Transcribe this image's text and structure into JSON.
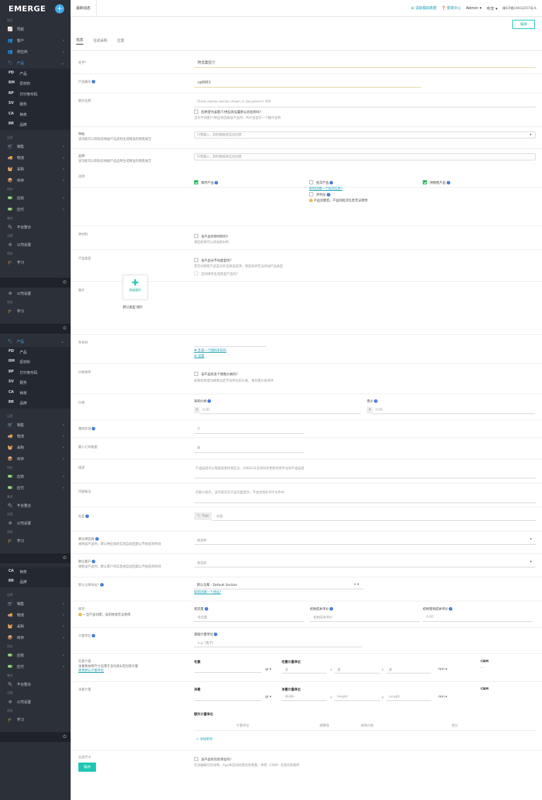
{
  "app": {
    "logo": "EMERGE",
    "news_tab": "最新动态"
  },
  "topbar": {
    "clear_demo": "清除模拟数据",
    "help": "帮助中心",
    "user": "Admin",
    "lang": "中文",
    "icp": "闽ICP备19012257号-6"
  },
  "sidebar": {
    "sec1": "报告",
    "nav": "导航",
    "customer": "客户",
    "supplier": "供应商",
    "product": "产品",
    "subs": [
      {
        "ab": "PD",
        "label": "产品"
      },
      {
        "ab": "RM",
        "label": "原材料"
      },
      {
        "ab": "BP",
        "label": "打印条形码"
      },
      {
        "ab": "SV",
        "label": "服务"
      },
      {
        "ab": "CA",
        "label": "种类"
      },
      {
        "ab": "BR",
        "label": "品牌"
      }
    ],
    "sec2": "运营",
    "sales": "销售",
    "logistics": "物流",
    "purchase": "采购",
    "inventory": "库存",
    "sec3": "财务",
    "receivable": "应收",
    "payable": "应付",
    "sec4": "集成",
    "platform": "平台整合",
    "sec5": "设置",
    "company": "公司设置",
    "sec6": "帮助",
    "learn": "学习"
  },
  "form": {
    "save_top": "保存",
    "tabs": [
      "信息",
      "往返采购",
      "位置"
    ],
    "name_label": "名字*",
    "name_value": "阿戈莫拉汀",
    "code_label": "产品编号",
    "code_value": "cp0001",
    "alias_label": "额外名称",
    "alias_hint": "These names will be shown in document's PDF",
    "alias_check": "您希望为该客户/供应商设置默认的名称吗?",
    "alias_desc": "当为不同客户/供应商选择该产品时，PDF会显示一个额外名称",
    "category_label": "种类",
    "category_desc": "该功能可以帮助您根据产品类别生成精准的销售报告",
    "category_ph": "只需输入，新的数据将自动创建",
    "brand_label": "品牌",
    "brand_desc": "该功能可以帮助您根据产品品牌生成精准的销售报告",
    "brand_ph": "只需输入，新的数据将自动创建",
    "options_label": "选项",
    "opt_stock": "库存产品",
    "opt_batch": "批次产品",
    "opt_batch_link": "如何创建一个批次信息?",
    "opt_serial": "序列号",
    "opt_warn": "产品创建后，产品的批次信息无法更改",
    "opt_sales": "供销售产品",
    "raw_label": "原材料",
    "raw_check": "该产品有原材料吗?",
    "raw_desc": "稍后您将可以添加原材料",
    "type_label": "产品类型",
    "type_check": "该产品分不同类型吗?",
    "type_desc": "若在创建新产品是没有选择该选项，稍后您将无法添加产品类型",
    "type_auto": "自动填充生成类型产品吗?",
    "image_label": "图片",
    "add_image": "添加图片",
    "default_image": "默认类型 图片",
    "barcode_label": "条形码",
    "barcode_gen": "生成一个随机条形码",
    "barcode_set": "设置",
    "price_list_label": "价格清单",
    "price_list_check": "该产品有多个销售价格吗?",
    "price_list_desc": "如果您希望为顾客设定不同单位的价格，请创建价格清单",
    "price_label": "价格",
    "purchase_price": "采购价格",
    "sale_price": "售价",
    "price_prefix": "¥",
    "price_ph": "0.00",
    "reorder_label": "重购阶值",
    "reorder_value": "0",
    "moq_label": "最小订单数量",
    "moq_value": "0",
    "desc_label": "描述",
    "desc_ph": "产品描述可以帮助您更好地区分，EMERGE支持同步更新有赞平台的产品描述",
    "note_label": "内部备注",
    "note_ph": "内部小提示，该内容仅在产品页面显示，不会出现在PDF文件中",
    "tags_label": "标签",
    "tags_btn": "Tags",
    "tags_ph": "标签",
    "def_supplier_label": "默认供应商",
    "def_supplier_desc": "采购该产品时，默认供应商的信息自动匹配以节省您的时间",
    "select_ph": "请选择",
    "def_customer_label": "默认客户",
    "def_customer_desc": "销售该产品时，默认客户的信息将自动匹配以节省您的时间",
    "def_wh_label": "默认仓库地址*",
    "def_wh_value": "默认仓库 - Default Section",
    "def_wh_link": "如何创建一个地址?",
    "stock_label": "库存",
    "stock_warn": "一旦产品创建，该初始值无法更改",
    "stock_current": "现货量",
    "stock_current_ph": "现货量",
    "stock_cost": "初始成本单价",
    "stock_cost_ph": "初始成本单价",
    "stock_landed": "初始落地成本单价",
    "stock_landed_ph": "0.00",
    "unit_label": "计量单位",
    "unit_base": "基础计量单位",
    "unit_ph": "e.g. (瓶子)",
    "gross_label": "毛重计量",
    "gross_desc": "净重和体积尺寸应用于含包装&无包装计量",
    "gross_link": "更改默认计量单位",
    "gross_weight": "毛重",
    "gross_dim": "毛重计量单位",
    "cbm": "CBM",
    "unit_gr": "gr",
    "unit_mm": "mm",
    "dim_len_cn": "长",
    "dim_wid_cn": "宽",
    "dim_hei_cn": "高",
    "cbm_val": "--",
    "net_label": "净重计量",
    "net_weight": "净重",
    "net_dim": "净重计量单位",
    "dim_w": "Width",
    "dim_h": "Height",
    "dim_l": "Length",
    "extra_unit": "额外计量单位",
    "col_unit": "计量单位",
    "col_conv": "换算值",
    "col_pprice": "采购价格",
    "col_sprice": "售价",
    "add_new": "+ 添加新的",
    "pack_label": "包装尺寸",
    "pack_check": "该产品有包装单位吗?",
    "pack_desc": "在此编辑包装详情，App将自动创建含有重量、体积（CBM）信息的装箱单",
    "save_bottom": "保存"
  }
}
